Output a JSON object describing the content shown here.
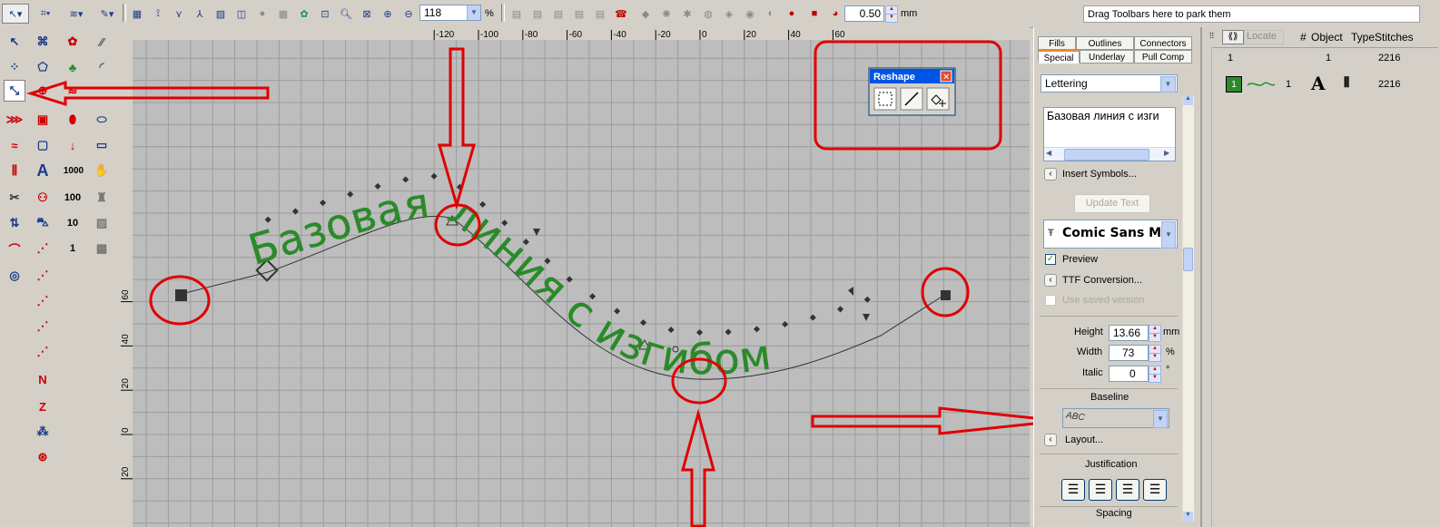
{
  "toolbar": {
    "zoom_value": "118",
    "zoom_unit": "%",
    "stitch_spacing_value": "0.50",
    "stitch_spacing_unit": "mm",
    "park_area_text": "Drag Toolbars here to park them"
  },
  "ruler": {
    "horizontal_ticks": [
      "-120",
      "-100",
      "-80",
      "-60",
      "-40",
      "-20",
      "0",
      "20",
      "40",
      "60"
    ],
    "vertical_ticks": [
      "60",
      "40",
      "20",
      "0",
      "20"
    ]
  },
  "reshape_toolbar": {
    "title": "Reshape",
    "close_glyph": "✕"
  },
  "design": {
    "lettering_text": "Базовая линия с изгибом",
    "lettering_color": "#2a8a2a",
    "annotation_color": "#e00000"
  },
  "panel": {
    "tabs_row1": [
      "Fills",
      "Outlines",
      "Connectors"
    ],
    "tabs_row2": [
      "Special",
      "Underlay",
      "Pull Comp"
    ],
    "active_tab": "Special",
    "type_select": "Lettering",
    "text_box_value": "Базовая линия с изги",
    "insert_symbols": "Insert Symbols...",
    "update_text": "Update Text",
    "font_name": "Comic Sans M..",
    "preview_label": "Preview",
    "preview_checked": true,
    "ttf_conversion": "TTF Conversion...",
    "use_saved_version": "Use saved version",
    "height_label": "Height",
    "height_value": "13.66",
    "height_unit": "mm",
    "width_label": "Width",
    "width_value": "73",
    "width_unit": "%",
    "italic_label": "Italic",
    "italic_value": "0",
    "italic_unit": "°",
    "baseline_title": "Baseline",
    "baseline_preview": "ABC",
    "layout_label": "Layout...",
    "justification_title": "Justification",
    "spacing_title": "Spacing"
  },
  "object_list": {
    "toolbar_locate": "Locate",
    "headers": [
      "#",
      "Object",
      "Type",
      "Stitches"
    ],
    "summary_row": {
      "number": "1",
      "object": "1",
      "stitches": "2216"
    },
    "row": {
      "index": "1",
      "number": "1",
      "stitches": "2216"
    }
  }
}
